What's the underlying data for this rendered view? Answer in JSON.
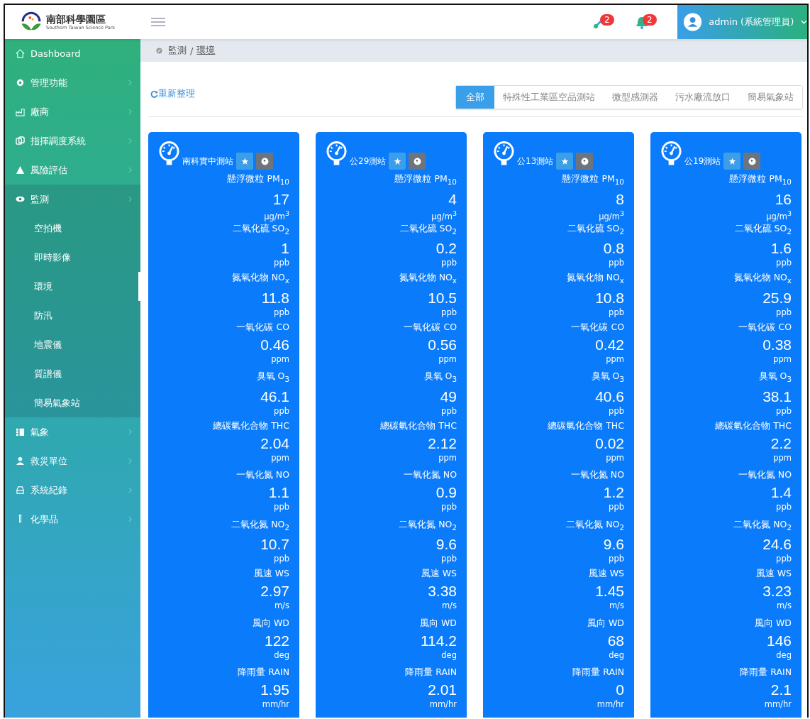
{
  "header": {
    "logo_title": "南部科學園區",
    "logo_subtitle": "Southern Taiwan Science Park",
    "notifications": [
      {
        "count": "2"
      },
      {
        "count": "2"
      }
    ],
    "user": "admin (系統管理員)"
  },
  "sidebar": {
    "items": [
      {
        "label": "Dashboard",
        "kind": "link",
        "expanded": false
      },
      {
        "label": "管理功能",
        "kind": "menu",
        "expanded": false
      },
      {
        "label": "廠商",
        "kind": "menu",
        "expanded": false
      },
      {
        "label": "指揮調度系統",
        "kind": "menu",
        "expanded": false
      },
      {
        "label": "風險評估",
        "kind": "menu",
        "expanded": false
      },
      {
        "label": "監測",
        "kind": "menu",
        "expanded": true,
        "children": [
          {
            "label": "空拍機",
            "selected": false
          },
          {
            "label": "即時影像",
            "selected": false
          },
          {
            "label": "環境",
            "selected": true
          },
          {
            "label": "防汛",
            "selected": false
          },
          {
            "label": "地震儀",
            "selected": false
          },
          {
            "label": "質譜儀",
            "selected": false
          },
          {
            "label": "簡易氣象站",
            "selected": false
          }
        ]
      },
      {
        "label": "氣象",
        "kind": "menu",
        "expanded": false
      },
      {
        "label": "救災單位",
        "kind": "menu",
        "expanded": false
      },
      {
        "label": "系統紀錄",
        "kind": "menu",
        "expanded": false
      },
      {
        "label": "化學品",
        "kind": "menu",
        "expanded": false
      }
    ]
  },
  "breadcrumb": [
    "監測",
    "/",
    "環境"
  ],
  "refresh": "重新整理",
  "tabs": [
    {
      "label": "全部",
      "selected": true
    },
    {
      "label": "特殊性工業區空品測站",
      "selected": false
    },
    {
      "label": "微型感測器",
      "selected": false
    },
    {
      "label": "污水廠流放口",
      "selected": false
    },
    {
      "label": "簡易氣象站",
      "selected": false
    }
  ],
  "stations": [
    {
      "name": "南科實中測站",
      "metrics": [
        {
          "label": "懸浮微粒 PM$_{10}$",
          "value": "17",
          "unit": "μg/m$^{3}$"
        },
        {
          "label": "二氧化硫 SO$_{2}$",
          "value": "1",
          "unit": "ppb"
        },
        {
          "label": "氮氧化物 NO$_{x}$",
          "value": "11.8",
          "unit": "ppb"
        },
        {
          "label": "一氧化碳 CO",
          "value": "0.46",
          "unit": "ppm"
        },
        {
          "label": "臭氧 O$_{3}$",
          "value": "46.1",
          "unit": "ppb"
        },
        {
          "label": "總碳氫化合物 THC",
          "value": "2.04",
          "unit": "ppm"
        },
        {
          "label": "一氧化氮 NO",
          "value": "1.1",
          "unit": "ppb"
        },
        {
          "label": "二氧化氮 NO$_{2}$",
          "value": "10.7",
          "unit": "ppb"
        },
        {
          "label": "風速 WS",
          "value": "2.97",
          "unit": "m/s"
        },
        {
          "label": "風向 WD",
          "value": "122",
          "unit": "deg"
        },
        {
          "label": "降雨量 RAIN",
          "value": "1.95",
          "unit": "mm/hr"
        }
      ]
    },
    {
      "name": "公29測站",
      "metrics": [
        {
          "label": "懸浮微粒 PM$_{10}$",
          "value": "4",
          "unit": "μg/m$^{3}$"
        },
        {
          "label": "二氧化硫 SO$_{2}$",
          "value": "0.2",
          "unit": "ppb"
        },
        {
          "label": "氮氧化物 NO$_{x}$",
          "value": "10.5",
          "unit": "ppb"
        },
        {
          "label": "一氧化碳 CO",
          "value": "0.56",
          "unit": "ppm"
        },
        {
          "label": "臭氧 O$_{3}$",
          "value": "49",
          "unit": "ppb"
        },
        {
          "label": "總碳氫化合物 THC",
          "value": "2.12",
          "unit": "ppm"
        },
        {
          "label": "一氧化氮 NO",
          "value": "0.9",
          "unit": "ppb"
        },
        {
          "label": "二氧化氮 NO$_{2}$",
          "value": "9.6",
          "unit": "ppb"
        },
        {
          "label": "風速 WS",
          "value": "3.38",
          "unit": "m/s"
        },
        {
          "label": "風向 WD",
          "value": "114.2",
          "unit": "deg"
        },
        {
          "label": "降雨量 RAIN",
          "value": "2.01",
          "unit": "mm/hr"
        }
      ]
    },
    {
      "name": "公13測站",
      "metrics": [
        {
          "label": "懸浮微粒 PM$_{10}$",
          "value": "8",
          "unit": "μg/m$^{3}$"
        },
        {
          "label": "二氧化硫 SO$_{2}$",
          "value": "0.8",
          "unit": "ppb"
        },
        {
          "label": "氮氧化物 NO$_{x}$",
          "value": "10.8",
          "unit": "ppb"
        },
        {
          "label": "一氧化碳 CO",
          "value": "0.42",
          "unit": "ppm"
        },
        {
          "label": "臭氧 O$_{3}$",
          "value": "40.6",
          "unit": "ppb"
        },
        {
          "label": "總碳氫化合物 THC",
          "value": "0.02",
          "unit": "ppm"
        },
        {
          "label": "一氧化氮 NO",
          "value": "1.2",
          "unit": "ppb"
        },
        {
          "label": "二氧化氮 NO$_{2}$",
          "value": "9.6",
          "unit": "ppb"
        },
        {
          "label": "風速 WS",
          "value": "1.45",
          "unit": "m/s"
        },
        {
          "label": "風向 WD",
          "value": "68",
          "unit": "deg"
        },
        {
          "label": "降雨量 RAIN",
          "value": "0",
          "unit": "mm/hr"
        }
      ]
    },
    {
      "name": "公19測站",
      "metrics": [
        {
          "label": "懸浮微粒 PM$_{10}$",
          "value": "16",
          "unit": "μg/m$^{3}$"
        },
        {
          "label": "二氧化硫 SO$_{2}$",
          "value": "1.6",
          "unit": "ppb"
        },
        {
          "label": "氮氧化物 NO$_{x}$",
          "value": "25.9",
          "unit": "ppb"
        },
        {
          "label": "一氧化碳 CO",
          "value": "0.38",
          "unit": "ppm"
        },
        {
          "label": "臭氧 O$_{3}$",
          "value": "38.1",
          "unit": "ppb"
        },
        {
          "label": "總碳氫化合物 THC",
          "value": "2.2",
          "unit": "ppm"
        },
        {
          "label": "一氧化氮 NO",
          "value": "1.4",
          "unit": "ppb"
        },
        {
          "label": "二氧化氮 NO$_{2}$",
          "value": "24.6",
          "unit": "ppb"
        },
        {
          "label": "風速 WS",
          "value": "3.23",
          "unit": "m/s"
        },
        {
          "label": "風向 WD",
          "value": "146",
          "unit": "deg"
        },
        {
          "label": "降雨量 RAIN",
          "value": "2.1",
          "unit": "mm/hr"
        }
      ]
    }
  ]
}
